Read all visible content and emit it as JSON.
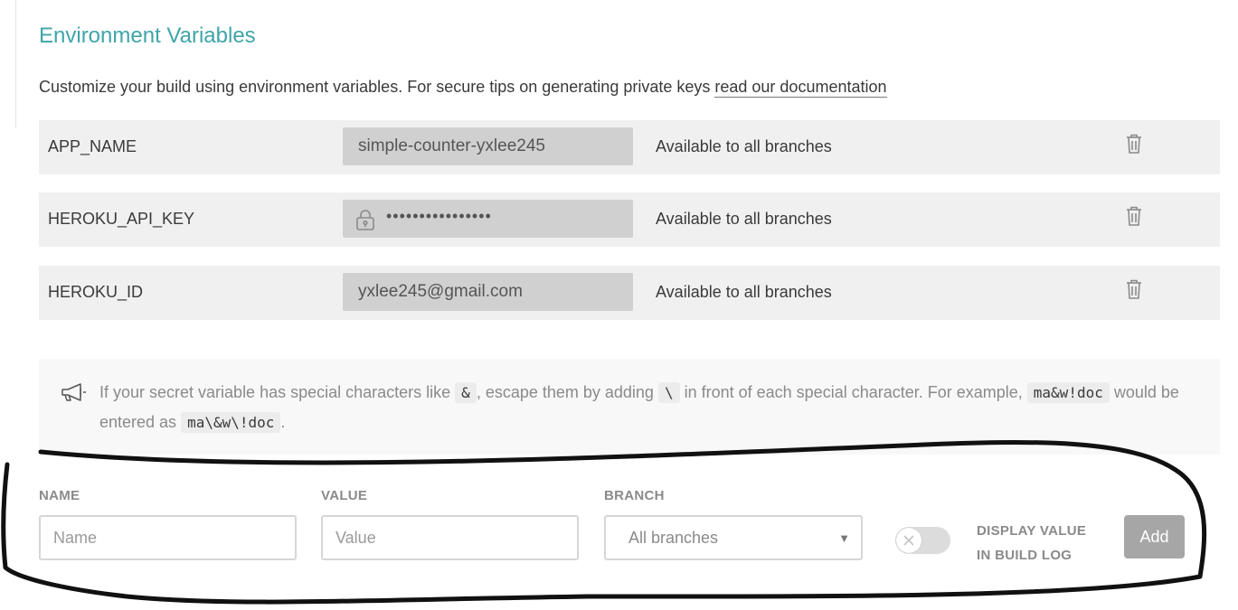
{
  "section": {
    "title": "Environment Variables",
    "description": "Customize your build using environment variables. For secure tips on generating private keys ",
    "doc_link": "read our documentation"
  },
  "variables": [
    {
      "name": "APP_NAME",
      "value": "simple-counter-yxlee245",
      "secure": false,
      "branch": "Available to all branches"
    },
    {
      "name": "HEROKU_API_KEY",
      "value": "••••••••••••••••",
      "secure": true,
      "branch": "Available to all branches"
    },
    {
      "name": "HEROKU_ID",
      "value": "yxlee245@gmail.com",
      "secure": false,
      "branch": "Available to all branches"
    }
  ],
  "notice": {
    "part1": "If your secret variable has special characters like ",
    "code1": "&",
    "part2": ", escape them by adding ",
    "code2": "\\",
    "part3": " in front of each special character. For example, ",
    "code3": "ma&w!doc",
    "part4": " would be entered as ",
    "code4": "ma\\&w\\!doc",
    "part5": "."
  },
  "form": {
    "name_label": "NAME",
    "name_placeholder": "Name",
    "value_label": "VALUE",
    "value_placeholder": "Value",
    "branch_label": "BRANCH",
    "branch_selected": "All branches",
    "display_label_line1": "DISPLAY VALUE",
    "display_label_line2": "IN BUILD LOG",
    "display_toggle_on": false,
    "add_label": "Add"
  },
  "colors": {
    "accent": "#3fa5a8",
    "row_bg": "#f0f0f0",
    "value_bg": "#d0d0d0",
    "button_bg": "#a6a6a6"
  }
}
